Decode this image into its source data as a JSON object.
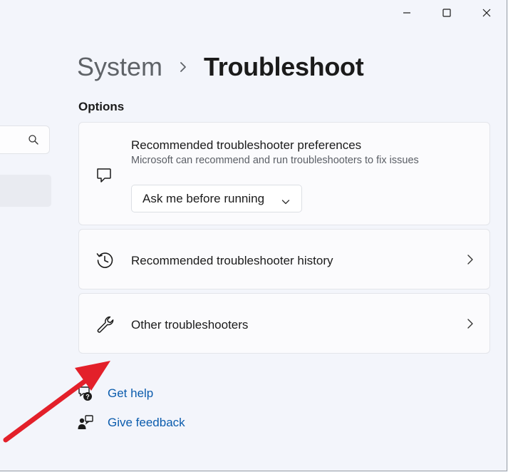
{
  "window": {
    "controls": {
      "minimize_icon": "minimize-icon",
      "maximize_icon": "maximize-icon",
      "close_icon": "close-icon"
    }
  },
  "nav": {
    "search_icon": "search-icon"
  },
  "breadcrumb": {
    "parent": "System",
    "separator_icon": "chevron-right-icon",
    "current": "Troubleshoot"
  },
  "options": {
    "section_title": "Options",
    "preferences": {
      "icon": "chat-bubble-icon",
      "title": "Recommended troubleshooter preferences",
      "subtitle": "Microsoft can recommend and run troubleshooters to fix issues",
      "dropdown_value": "Ask me before running"
    },
    "history": {
      "icon": "history-icon",
      "title": "Recommended troubleshooter history"
    },
    "other": {
      "icon": "wrench-icon",
      "title": "Other troubleshooters"
    }
  },
  "links": {
    "get_help": "Get help",
    "give_feedback": "Give feedback"
  },
  "colors": {
    "background": "#f3f5fb",
    "card": "#fbfbfd",
    "link": "#0b5cad",
    "annotation_arrow": "#e3202a"
  }
}
